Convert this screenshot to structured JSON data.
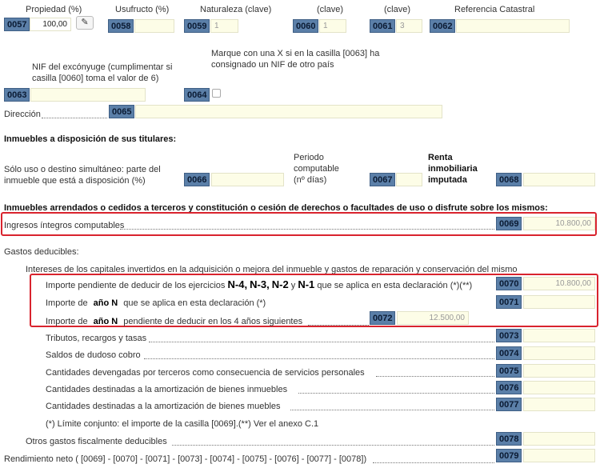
{
  "row1": {
    "propiedad_label": "Propiedad (%)",
    "usufructo_label": "Usufructo (%)",
    "naturaleza_label": "Naturaleza (clave)",
    "clave1_label": "(clave)",
    "clave2_label": "(clave)",
    "referencia_label": "Referencia Catastral",
    "b0057": "0057",
    "v0057": "100,00",
    "pencil": "✎",
    "b0058": "0058",
    "b0059": "0059",
    "v0059": "1",
    "b0060": "0060",
    "v0060": "1",
    "b0061": "0061",
    "v0061": "3",
    "b0062": "0062"
  },
  "row2": {
    "nif_label": "NIF del excónyuge (cumplimentar si casilla [0060] toma el valor de 6)",
    "marque_label": "Marque con una X si en la casilla [0063] ha consignado un NIF de otro país",
    "b0063": "0063",
    "b0064": "0064"
  },
  "direccion": {
    "label": "Dirección",
    "b0065": "0065"
  },
  "disposicion": {
    "title": "Inmuebles a disposición de sus titulares:",
    "uso_label": "Sólo uso o destino simultáneo: parte del inmueble que está a disposición (%)",
    "b0066": "0066",
    "periodo_label": "Periodo computable (nº días)",
    "b0067": "0067",
    "renta_label": "Renta inmobiliaria imputada",
    "b0068": "0068"
  },
  "arrendados": {
    "title": "Inmuebles arrendados o cedidos a terceros y constitución o cesión de derechos o facultades de uso o disfrute sobre los mismos:",
    "ingresos_label": "Ingresos íntegros computables",
    "b0069": "0069",
    "v0069": "10.800,00"
  },
  "gastos": {
    "title": "Gastos deducibles:",
    "intereses_title": "Intereses de los capitales invertidos en la adquisición o mejora del inmueble y gastos de reparación y conservación del mismo",
    "r0070": {
      "a": "Importe pendiente de deducir de los ejercicios",
      "n4": "N-4",
      "c1": ",",
      "n3": "N-3",
      "c2": ",",
      "n2": "N-2",
      "y": "y",
      "n1": "N-1",
      "b": "que se aplica en esta declaración (*)(**)",
      "box": "0070",
      "val": "10.800,00"
    },
    "r0071": {
      "a": "Importe de",
      "anio": "año N",
      "b": "que se aplica en esta declaración (*)",
      "box": "0071"
    },
    "r0072": {
      "a": "Importe de",
      "anio": "año N",
      "b": "pendiente de deducir en los 4 años siguientes",
      "box": "0072",
      "val": "12.500,00"
    },
    "tributos": "Tributos, recargos y tasas",
    "b0073": "0073",
    "saldos": "Saldos de dudoso cobro",
    "b0074": "0074",
    "cantidades": "Cantidades devengadas por terceros como consecuencia de servicios personales",
    "b0075": "0075",
    "amort_inm": "Cantidades destinadas a la amortización de bienes inmuebles",
    "b0076": "0076",
    "amort_mue": "Cantidades destinadas a la amortización de bienes muebles",
    "b0077": "0077",
    "nota": "(*) Límite conjunto: el importe de la casilla [0069].(**) Ver el anexo C.1",
    "otros": "Otros gastos fiscalmente deducibles",
    "b0078": "0078",
    "rendimiento": "Rendimiento neto ( [0069] - [0070] - [0071] - [0073] - [0074] - [0075] - [0076] - [0077] - [0078])",
    "b0079": "0079"
  },
  "colors": {
    "box": "#5b7fa8",
    "input": "#fdfde7",
    "highlight": "#d9242e"
  }
}
